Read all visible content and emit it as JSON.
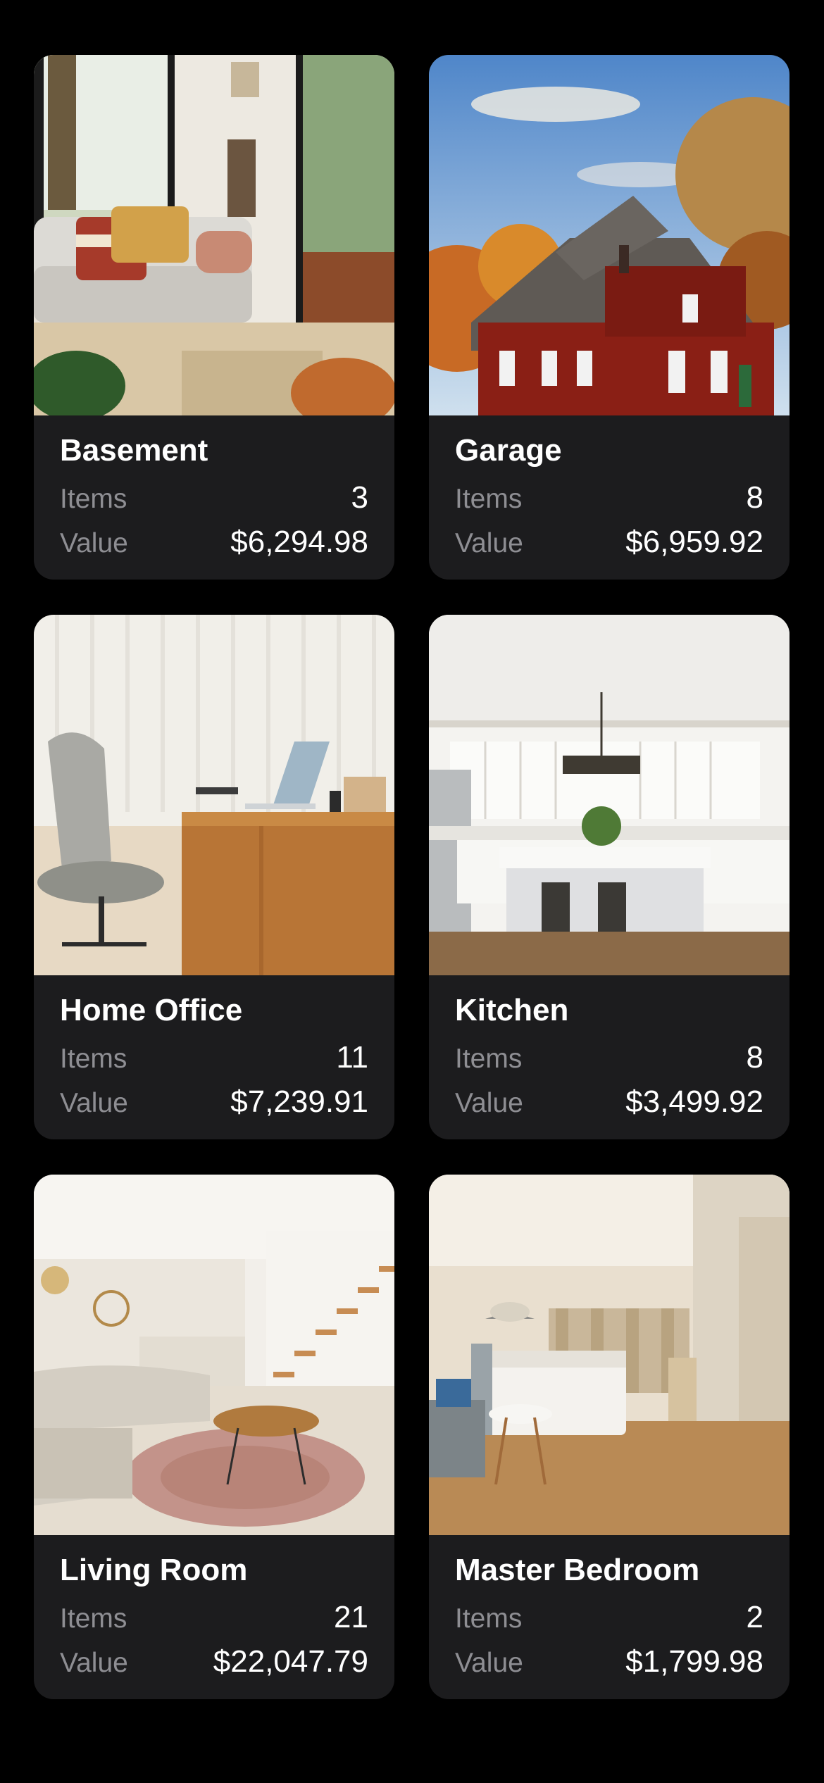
{
  "rooms": [
    {
      "name": "Basement",
      "items_label": "Items",
      "items": "3",
      "value_label": "Value",
      "value": "$6,294.98",
      "photo": "basement-photo"
    },
    {
      "name": "Garage",
      "items_label": "Items",
      "items": "8",
      "value_label": "Value",
      "value": "$6,959.92",
      "photo": "garage-photo"
    },
    {
      "name": "Home Office",
      "items_label": "Items",
      "items": "11",
      "value_label": "Value",
      "value": "$7,239.91",
      "photo": "home-office-photo"
    },
    {
      "name": "Kitchen",
      "items_label": "Items",
      "items": "8",
      "value_label": "Value",
      "value": "$3,499.92",
      "photo": "kitchen-photo"
    },
    {
      "name": "Living Room",
      "items_label": "Items",
      "items": "21",
      "value_label": "Value",
      "value": "$22,047.79",
      "photo": "living-room-photo"
    },
    {
      "name": "Master Bedroom",
      "items_label": "Items",
      "items": "2",
      "value_label": "Value",
      "value": "$1,799.98",
      "photo": "master-bedroom-photo"
    }
  ],
  "colors": {
    "background": "#000000",
    "card": "#1c1c1e",
    "label": "#8e8e93",
    "text": "#ffffff"
  }
}
